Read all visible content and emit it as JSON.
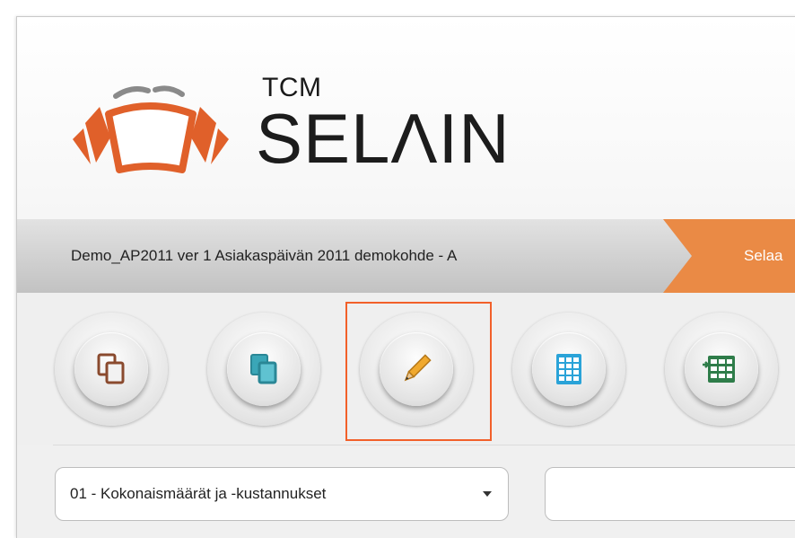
{
  "brand": {
    "small": "TCM",
    "large": "SELΛIN",
    "logo_icon": "orange-dome-logo-icon"
  },
  "breadcrumb": {
    "current_project": "Demo_AP2011 ver 1 Asiakaspäivän 2011 demokohde - A",
    "active_step": "Selaa"
  },
  "toolbar": {
    "buttons": [
      {
        "name": "copy-brown-icon",
        "highlighted": false
      },
      {
        "name": "copy-teal-icon",
        "highlighted": false
      },
      {
        "name": "pencil-edit-icon",
        "highlighted": true
      },
      {
        "name": "table-grid-icon",
        "highlighted": false
      },
      {
        "name": "table-import-icon",
        "highlighted": false
      }
    ],
    "highlight_color": "#f2602a"
  },
  "filters": {
    "category_select_value": "01 - Kokonaismäärät ja -kustannukset",
    "search_value": ""
  },
  "colors": {
    "accent_orange": "#ea8a45",
    "logo_orange": "#e0602a"
  }
}
